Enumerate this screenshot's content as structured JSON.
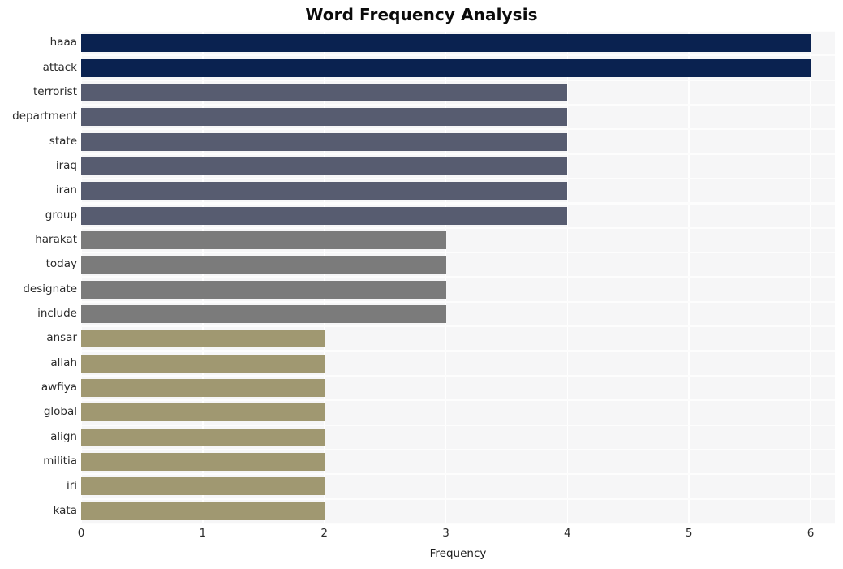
{
  "chart_data": {
    "type": "bar",
    "orientation": "horizontal",
    "title": "Word Frequency Analysis",
    "xlabel": "Frequency",
    "ylabel": "",
    "xlim": [
      0,
      6.2
    ],
    "xticks": [
      "0",
      "1",
      "2",
      "3",
      "4",
      "5",
      "6"
    ],
    "xtick_values": [
      0,
      1,
      2,
      3,
      4,
      5,
      6
    ],
    "grid": true,
    "grid_axis": "both",
    "legend": "none",
    "categories": [
      "haaa",
      "attack",
      "terrorist",
      "department",
      "state",
      "iraq",
      "iran",
      "group",
      "harakat",
      "today",
      "designate",
      "include",
      "ansar",
      "allah",
      "awfiya",
      "global",
      "align",
      "militia",
      "iri",
      "kata"
    ],
    "values": [
      6,
      6,
      4,
      4,
      4,
      4,
      4,
      4,
      3,
      3,
      3,
      3,
      2,
      2,
      2,
      2,
      2,
      2,
      2,
      2
    ],
    "bar_colors": [
      "#0a2250",
      "#0a2250",
      "#575c70",
      "#575c70",
      "#575c70",
      "#575c70",
      "#575c70",
      "#575c70",
      "#7b7b7b",
      "#7b7b7b",
      "#7b7b7b",
      "#7b7b7b",
      "#a09871",
      "#a09871",
      "#a09871",
      "#a09871",
      "#a09871",
      "#a09871",
      "#a09871",
      "#a09871"
    ]
  },
  "colors": {
    "navy": "#0a2250",
    "slate": "#575c70",
    "gray": "#7b7b7b",
    "khaki": "#a09871",
    "plot_background": "#f6f6f7",
    "gridline": "#ffffff",
    "figure_background": "#ffffff",
    "text": "#2b2b2b",
    "title_text": "#0b0b0b"
  }
}
